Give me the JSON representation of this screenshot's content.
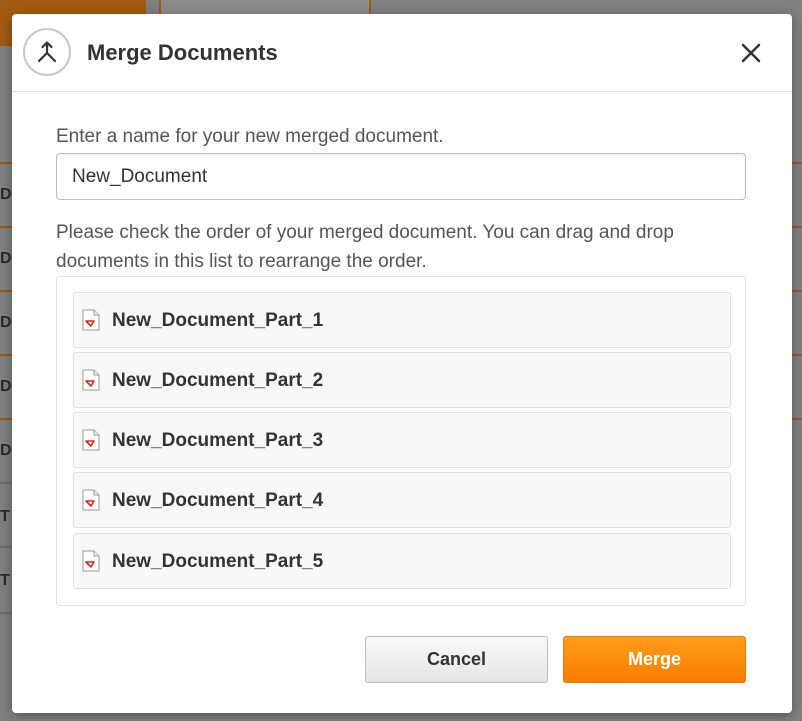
{
  "dialog": {
    "title": "Merge Documents",
    "name_label": "Enter a name for your new merged document.",
    "name_value": "New_Document",
    "order_label": "Please check the order of your merged document. You can drag and drop documents in this list to rearrange the order.",
    "documents": [
      {
        "name": "New_Document_Part_1",
        "icon": "pdf-file-icon"
      },
      {
        "name": "New_Document_Part_2",
        "icon": "pdf-file-icon"
      },
      {
        "name": "New_Document_Part_3",
        "icon": "pdf-file-icon"
      },
      {
        "name": "New_Document_Part_4",
        "icon": "pdf-file-icon"
      },
      {
        "name": "New_Document_Part_5",
        "icon": "pdf-file-icon"
      }
    ],
    "cancel_label": "Cancel",
    "merge_label": "Merge"
  },
  "colors": {
    "accent": "#f98a0e",
    "background_overlay": "#808080"
  }
}
